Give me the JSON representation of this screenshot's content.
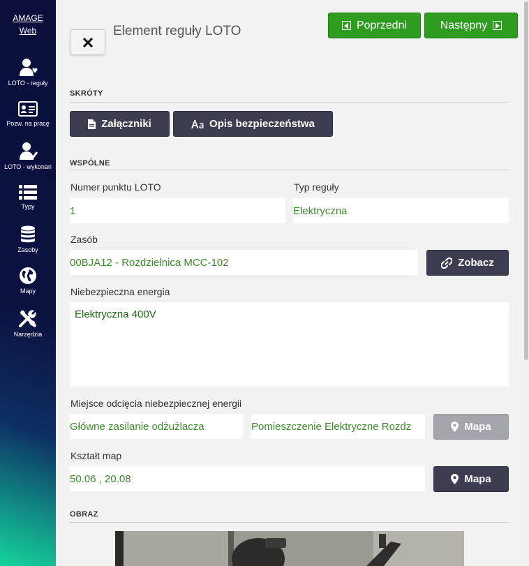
{
  "app": {
    "brand_line1": "AMAGE",
    "brand_line2": "Web"
  },
  "sidebar": {
    "items": [
      {
        "label": "LOTO - reguły",
        "icon": "user-heart-icon"
      },
      {
        "label": "Pozw. na pracę",
        "icon": "id-card-icon"
      },
      {
        "label": "LOTO - wykonan",
        "icon": "user-check-icon"
      },
      {
        "label": "Typy",
        "icon": "list-icon"
      },
      {
        "label": "Zasoby",
        "icon": "database-icon"
      },
      {
        "label": "Mapy",
        "icon": "globe-icon"
      },
      {
        "label": "Narzędzia",
        "icon": "tools-icon"
      }
    ]
  },
  "header": {
    "title": "Element reguły LOTO",
    "prev_label": "Poprzedni",
    "next_label": "Następny"
  },
  "sections": {
    "shortcuts": "SKRÓTY",
    "common": "WSPÓLNE",
    "image": "OBRAZ"
  },
  "shortcuts": {
    "attachments_label": "Załączniki",
    "safety_label": "Opis bezpieczeństwa"
  },
  "fields": {
    "loto_point_label": "Numer punktu LOTO",
    "loto_point_value": "1",
    "rule_type_label": "Typ reguły",
    "rule_type_value": "Elektryczna",
    "asset_label": "Zasób",
    "asset_value": "00BJA12 - Rozdzielnica MCC-102",
    "view_label": "Zobacz",
    "energy_label": "Niebezpieczna energia",
    "energy_value": "Elektryczna 400V",
    "cutoff_label": "Miejsce odcięcia niebezpiecznej energii",
    "cutoff_value1": "Główne zasilanie odżużlacza",
    "cutoff_value2": "Pomieszczenie Elektryczne Rozdz",
    "map_label": "Mapa",
    "shape_label": "Kształt map",
    "shape_value": "50.06 , 20.08",
    "shape_map_label": "Mapa"
  },
  "colors": {
    "sidebar": "#0b1240",
    "green_button": "#2d9c1f",
    "dark_button": "#3d3d52",
    "value_text": "#3a8a2a"
  }
}
